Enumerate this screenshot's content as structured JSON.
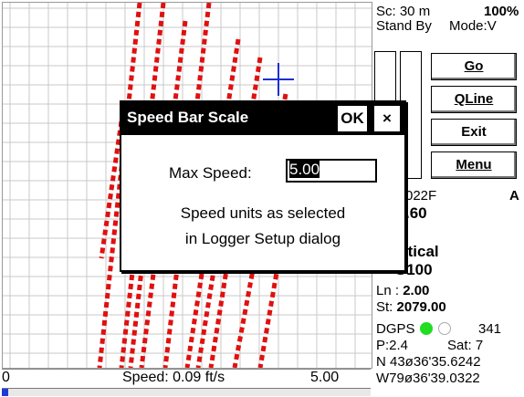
{
  "map": {
    "crosshair_color": "#1e2fd0",
    "track_color": "#e01010"
  },
  "speed_bar": {
    "min_label": "0",
    "speed_text": "Speed: 0.09 ft/s",
    "max_label": "5.00",
    "fill_fraction": 0.018
  },
  "panel": {
    "scale": "Sc:  30 m",
    "zoom": "100%",
    "status": "Stand By",
    "mode": "Mode:V",
    "buttons": {
      "go": "Go",
      "qline": "QLine",
      "exit": "Exit",
      "menu": "Menu"
    },
    "file_code": "022F",
    "file_suffix": "A",
    "value_partial": ".60",
    "orientation_label": "rtical",
    "line_type": "G100",
    "ln": "Ln : 2.00",
    "st": "St:  2079.00",
    "gps_mode": "DGPS",
    "gps_count": "341",
    "pdop": "P:2.4",
    "sat": "Sat:  7",
    "lat": "N 43ø36'35.6242",
    "lon": "W79ø36'39.0322",
    "dot_colors": [
      "#22dd22",
      "#ffffff"
    ]
  },
  "dialog": {
    "title": "Speed Bar Scale",
    "ok_label": "OK",
    "close_label": "×",
    "max_speed_label": "Max Speed:",
    "max_speed_value": "5.00",
    "note_line1": "Speed units as selected",
    "note_line2": "in Logger Setup dialog"
  }
}
